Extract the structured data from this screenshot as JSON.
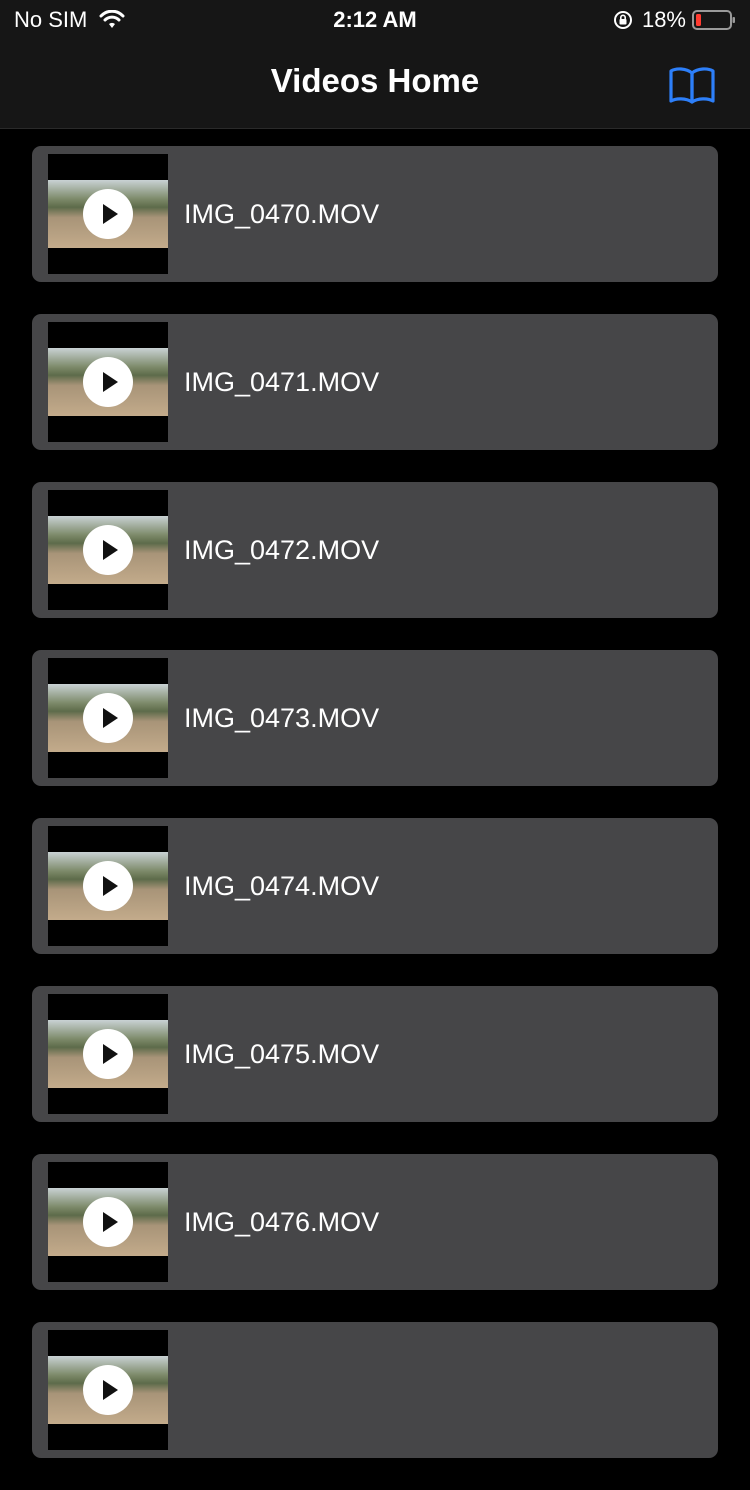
{
  "status": {
    "carrier": "No SIM",
    "time": "2:12 AM",
    "battery": "18%"
  },
  "nav": {
    "title": "Videos Home",
    "book_icon": "book-icon",
    "accent": "#2d7ff9"
  },
  "videos": [
    {
      "name": "IMG_0470.MOV"
    },
    {
      "name": "IMG_0471.MOV"
    },
    {
      "name": "IMG_0472.MOV"
    },
    {
      "name": "IMG_0473.MOV"
    },
    {
      "name": "IMG_0474.MOV"
    },
    {
      "name": "IMG_0475.MOV"
    },
    {
      "name": "IMG_0476.MOV"
    },
    {
      "name": ""
    }
  ]
}
